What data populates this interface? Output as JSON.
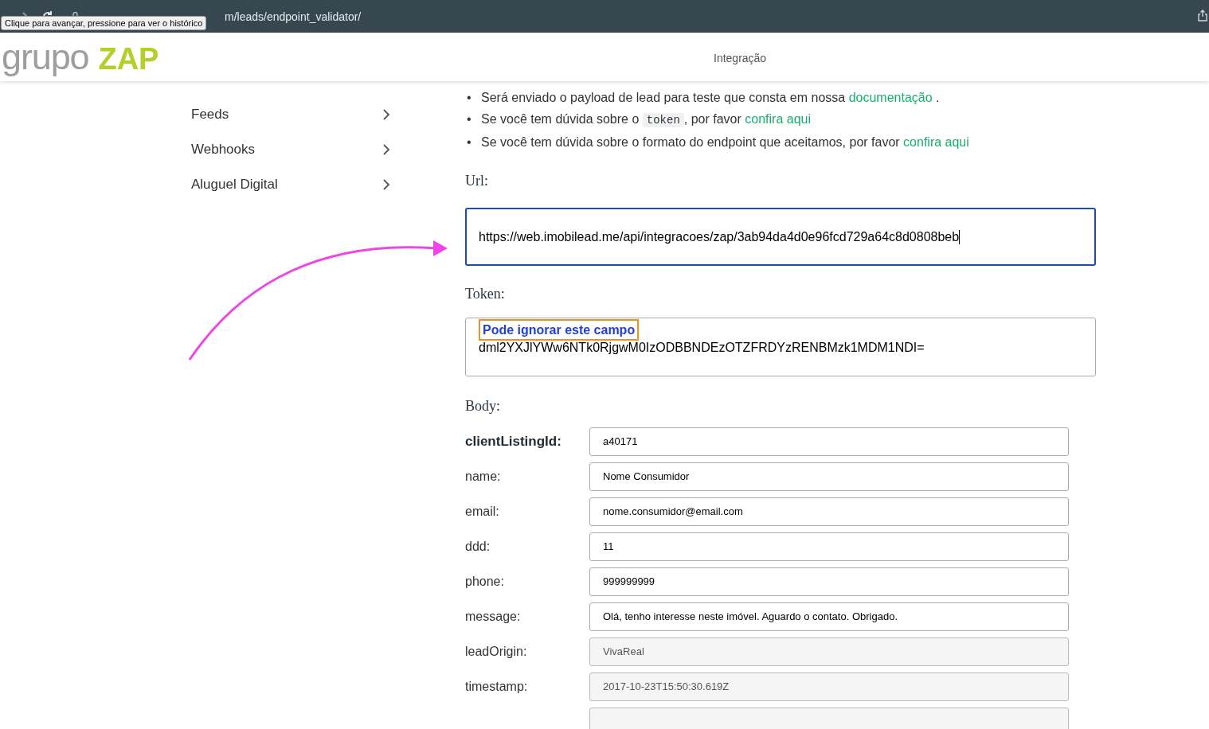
{
  "browser": {
    "url": "m/leads/endpoint_validator/",
    "tooltip": "Clique para avançar, pressione para ver o histórico"
  },
  "header": {
    "logo_text": "grupo",
    "logo_brand": "ZAP",
    "title": "Integração"
  },
  "sidebar": {
    "items": [
      {
        "label": "Feeds"
      },
      {
        "label": "Webhooks"
      },
      {
        "label": "Aluguel Digital"
      }
    ]
  },
  "bullets": [
    [
      {
        "kind": "marker",
        "text": "•"
      },
      {
        "kind": "text",
        "text": "Será enviado o payload de lead para teste que consta em nossa "
      },
      {
        "kind": "link",
        "text": "documentação"
      },
      {
        "kind": "text",
        "text": " ."
      }
    ],
    [
      {
        "kind": "marker",
        "text": "•"
      },
      {
        "kind": "text",
        "text": "Se você tem dúvida sobre o "
      },
      {
        "kind": "code",
        "text": "token"
      },
      {
        "kind": "text",
        "text": ", por favor "
      },
      {
        "kind": "link",
        "text": "confira aqui"
      }
    ],
    [
      {
        "kind": "marker",
        "text": "•"
      },
      {
        "kind": "text",
        "text": "Se você tem dúvida sobre o formato do endpoint que aceitamos, por favor "
      },
      {
        "kind": "link",
        "text": "confira aqui"
      }
    ]
  ],
  "url_section": {
    "label": "Url:",
    "value": "https://web.imobilead.me/api/integracoes/zap/3ab94da4d0e96fcd729a64c8d0808beb",
    "focused": true
  },
  "token_section": {
    "label": "Token:",
    "note": "Pode ignorar este campo",
    "value": "dml2YXJlYWw6NTk0RjgwM0IzODBBNDEzOTZFRDYzRENBMzk1MDM1NDI="
  },
  "body_section": {
    "label": "Body:",
    "fields": [
      {
        "label": "clientListingId:",
        "value": "a40171",
        "bold": true,
        "disabled": false
      },
      {
        "label": "name:",
        "value": "Nome Consumidor",
        "bold": false,
        "disabled": false
      },
      {
        "label": "email:",
        "value": "nome.consumidor@email.com",
        "bold": false,
        "disabled": false
      },
      {
        "label": "ddd:",
        "value": "11",
        "bold": false,
        "disabled": false
      },
      {
        "label": "phone:",
        "value": "999999999",
        "bold": false,
        "disabled": false
      },
      {
        "label": "message:",
        "value": "Olá, tenho interesse neste imóvel. Aguardo o contato. Obrigado.",
        "bold": false,
        "disabled": false
      },
      {
        "label": "leadOrigin:",
        "value": "VivaReal",
        "bold": false,
        "disabled": true
      },
      {
        "label": "timestamp:",
        "value": "2017-10-23T15:50:30.619Z",
        "bold": false,
        "disabled": true
      },
      {
        "disabled": true
      }
    ]
  }
}
